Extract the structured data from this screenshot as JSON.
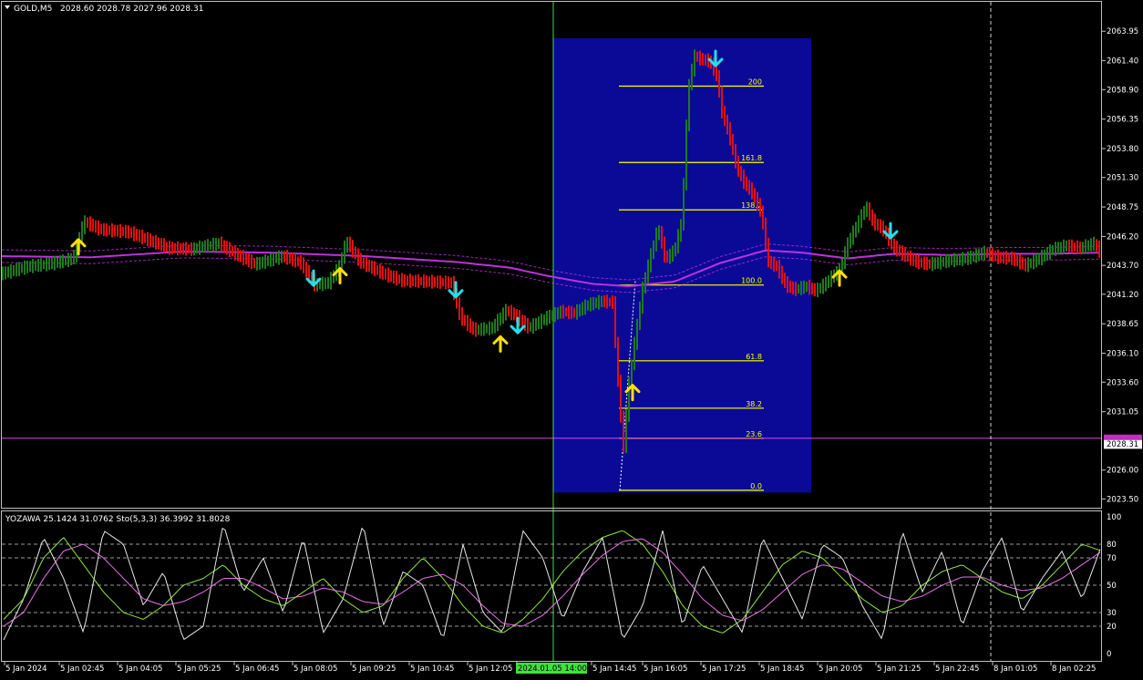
{
  "header": {
    "symbol": "GOLD,M5",
    "ohlc": "2028.60 2028.78 2027.96 2028.31"
  },
  "colors": {
    "background": "#000000",
    "bull": "#1e7a1e",
    "bear": "#e01010",
    "ma": "#c030e0",
    "fib_box": "#0a0a96",
    "fib_line": "#ffff00",
    "up_arrow": "#ffe000",
    "down_arrow": "#20e0f0",
    "grid": "#c0c0c0"
  },
  "icons": {
    "menu": "triangle-down-icon",
    "buy": "arrow-up-icon",
    "sell": "arrow-down-icon"
  },
  "chart_data": {
    "type": "candlestick",
    "price_axis": {
      "ylim": [
        2022.9,
        2064.6
      ],
      "ticks": [
        "2063.95",
        "2061.40",
        "2058.90",
        "2056.35",
        "2053.80",
        "2051.30",
        "2048.75",
        "2046.20",
        "2043.70",
        "2041.20",
        "2038.65",
        "2036.10",
        "2033.60",
        "2031.05",
        "2028.31",
        "2026.00",
        "2023.50"
      ],
      "current_price": "2028.31",
      "highlight_line": 2028.75
    },
    "time_axis": {
      "labels": [
        "5 Jan 2024",
        "5 Jan 02:45",
        "5 Jan 04:05",
        "5 Jan 05:25",
        "5 Jan 06:45",
        "5 Jan 08:05",
        "5 Jan 09:25",
        "5 Jan 10:45",
        "5 Jan 12:05",
        "2024.01.05 14:00",
        "5 Jan 14:45",
        "5 Jan 16:05",
        "5 Jan 17:25",
        "5 Jan 18:45",
        "5 Jan 20:05",
        "5 Jan 21:25",
        "5 Jan 22:45",
        "8 Jan 01:05",
        "8 Jan 02:25"
      ],
      "highlighted": "2024.01.05 14:00"
    },
    "fibonacci": {
      "low": 2024.25,
      "high": 2060.15,
      "levels": [
        {
          "label": "0.0",
          "value": 2024.25
        },
        {
          "label": "23.6",
          "value": 2028.75
        },
        {
          "label": "38.2",
          "value": 2031.35
        },
        {
          "label": "61.8",
          "value": 2035.45
        },
        {
          "label": "100.0",
          "value": 2042.0
        },
        {
          "label": "138.2",
          "value": 2048.5
        },
        {
          "label": "161.8",
          "value": 2052.6
        },
        {
          "label": "200",
          "value": 2059.2
        }
      ]
    },
    "signals": [
      {
        "type": "buy",
        "x": 86,
        "price": 2045.3
      },
      {
        "type": "sell",
        "x": 344,
        "price": 2042.6
      },
      {
        "type": "buy",
        "x": 373,
        "price": 2042.8
      },
      {
        "type": "sell",
        "x": 500,
        "price": 2041.6
      },
      {
        "type": "buy",
        "x": 549,
        "price": 2036.9
      },
      {
        "type": "sell",
        "x": 568,
        "price": 2038.5
      },
      {
        "type": "buy",
        "x": 694,
        "price": 2032.7
      },
      {
        "type": "sell",
        "x": 785,
        "price": 2061.6
      },
      {
        "type": "sell",
        "x": 977,
        "price": 2046.7
      },
      {
        "type": "buy",
        "x": 921,
        "price": 2042.6
      }
    ],
    "price_keypoints": [
      [
        2,
        2043.0
      ],
      [
        30,
        2043.6
      ],
      [
        60,
        2043.9
      ],
      [
        80,
        2044.3
      ],
      [
        92,
        2047.5
      ],
      [
        110,
        2046.8
      ],
      [
        140,
        2046.6
      ],
      [
        160,
        2046.0
      ],
      [
        185,
        2045.2
      ],
      [
        210,
        2045.1
      ],
      [
        240,
        2045.6
      ],
      [
        260,
        2044.6
      ],
      [
        280,
        2043.8
      ],
      [
        310,
        2044.5
      ],
      [
        330,
        2043.9
      ],
      [
        345,
        2042.0
      ],
      [
        360,
        2042.2
      ],
      [
        372,
        2043.6
      ],
      [
        380,
        2045.8
      ],
      [
        395,
        2044.0
      ],
      [
        420,
        2043.0
      ],
      [
        440,
        2042.4
      ],
      [
        470,
        2042.3
      ],
      [
        495,
        2042.2
      ],
      [
        505,
        2039.2
      ],
      [
        520,
        2038.1
      ],
      [
        540,
        2038.3
      ],
      [
        555,
        2039.8
      ],
      [
        565,
        2039.4
      ],
      [
        580,
        2038.3
      ],
      [
        600,
        2039.2
      ],
      [
        615,
        2039.7
      ],
      [
        630,
        2039.6
      ],
      [
        645,
        2040.3
      ],
      [
        660,
        2040.6
      ],
      [
        672,
        2040.5
      ],
      [
        679,
        2032.5
      ],
      [
        684,
        2028.0
      ],
      [
        690,
        2033.5
      ],
      [
        697,
        2037.5
      ],
      [
        705,
        2041.7
      ],
      [
        712,
        2044.0
      ],
      [
        722,
        2047.0
      ],
      [
        730,
        2044.2
      ],
      [
        740,
        2045.0
      ],
      [
        748,
        2047.5
      ],
      [
        755,
        2059.0
      ],
      [
        762,
        2061.8
      ],
      [
        770,
        2061.5
      ],
      [
        778,
        2061.4
      ],
      [
        786,
        2060.2
      ],
      [
        792,
        2057.0
      ],
      [
        800,
        2055.0
      ],
      [
        808,
        2052.3
      ],
      [
        815,
        2051.0
      ],
      [
        825,
        2050.0
      ],
      [
        835,
        2048.3
      ],
      [
        843,
        2044.0
      ],
      [
        852,
        2043.6
      ],
      [
        862,
        2042.0
      ],
      [
        872,
        2041.6
      ],
      [
        884,
        2041.9
      ],
      [
        895,
        2041.5
      ],
      [
        905,
        2042.1
      ],
      [
        915,
        2042.9
      ],
      [
        922,
        2043.4
      ],
      [
        930,
        2045.6
      ],
      [
        942,
        2047.5
      ],
      [
        950,
        2048.8
      ],
      [
        958,
        2047.4
      ],
      [
        968,
        2046.9
      ],
      [
        980,
        2045.3
      ],
      [
        992,
        2044.6
      ],
      [
        1005,
        2044.0
      ],
      [
        1020,
        2043.8
      ],
      [
        1040,
        2044.1
      ],
      [
        1060,
        2044.3
      ],
      [
        1080,
        2044.8
      ],
      [
        1095,
        2044.4
      ],
      [
        1110,
        2044.3
      ],
      [
        1125,
        2043.7
      ],
      [
        1140,
        2044.3
      ],
      [
        1155,
        2045.1
      ],
      [
        1170,
        2045.4
      ],
      [
        1185,
        2045.2
      ],
      [
        1200,
        2045.6
      ],
      [
        1210,
        2044.5
      ]
    ],
    "ma_keypoints": [
      [
        0,
        2044.5
      ],
      [
        100,
        2044.4
      ],
      [
        200,
        2044.9
      ],
      [
        300,
        2044.8
      ],
      [
        400,
        2044.5
      ],
      [
        500,
        2044.0
      ],
      [
        560,
        2043.5
      ],
      [
        600,
        2042.8
      ],
      [
        650,
        2042.1
      ],
      [
        690,
        2041.9
      ],
      [
        740,
        2042.3
      ],
      [
        790,
        2043.9
      ],
      [
        840,
        2045.0
      ],
      [
        880,
        2044.8
      ],
      [
        930,
        2044.3
      ],
      [
        980,
        2044.7
      ],
      [
        1040,
        2044.6
      ],
      [
        1100,
        2044.7
      ],
      [
        1150,
        2044.7
      ],
      [
        1210,
        2044.8
      ]
    ],
    "oscillator": {
      "title": "YOZAWA 25.1424 31.0762  Sto(5,3,3) 36.3992 31.8028",
      "ylim": [
        0,
        100
      ],
      "ticks": [
        "100",
        "80",
        "70",
        "50",
        "30",
        "20",
        "0"
      ],
      "levels": [
        80,
        70,
        50,
        30,
        20
      ],
      "series": [
        {
          "role": "fast",
          "color": "#ffffff",
          "values": [
            10,
            40,
            85,
            55,
            15,
            90,
            80,
            35,
            60,
            10,
            20,
            95,
            45,
            70,
            30,
            85,
            15,
            40,
            95,
            20,
            60,
            50,
            10,
            80,
            30,
            15,
            90,
            70,
            25,
            60,
            85,
            10,
            35,
            90,
            20,
            65,
            40,
            15,
            85,
            55,
            25,
            80,
            70,
            35,
            10,
            90,
            45,
            75,
            20,
            60,
            85,
            30,
            55,
            75,
            40,
            80
          ]
        },
        {
          "role": "slow_k",
          "color": "#a0ff40",
          "values": [
            25,
            40,
            70,
            85,
            65,
            45,
            30,
            25,
            35,
            50,
            55,
            65,
            50,
            40,
            35,
            45,
            55,
            40,
            30,
            35,
            55,
            70,
            55,
            35,
            20,
            15,
            25,
            40,
            60,
            75,
            85,
            90,
            80,
            60,
            35,
            20,
            15,
            25,
            45,
            65,
            75,
            70,
            55,
            40,
            30,
            35,
            50,
            60,
            65,
            55,
            45,
            40,
            50,
            65,
            80,
            75
          ]
        },
        {
          "role": "signal",
          "color": "#ff80ff",
          "values": [
            20,
            30,
            55,
            75,
            80,
            70,
            55,
            40,
            35,
            38,
            45,
            55,
            55,
            48,
            40,
            42,
            48,
            45,
            38,
            36,
            45,
            55,
            58,
            50,
            35,
            22,
            20,
            28,
            42,
            58,
            72,
            82,
            84,
            74,
            58,
            40,
            28,
            24,
            32,
            45,
            58,
            65,
            62,
            52,
            42,
            38,
            42,
            50,
            56,
            56,
            50,
            46,
            48,
            55,
            65,
            75
          ]
        }
      ]
    }
  }
}
